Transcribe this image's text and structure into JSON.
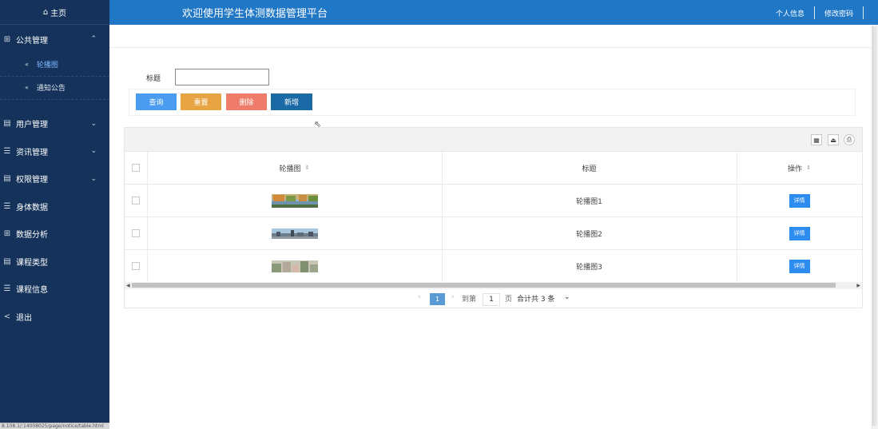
{
  "sidebar": {
    "home": "主页",
    "menu": [
      {
        "label": "公共管理",
        "icon": "grid-icon",
        "chevron": "up"
      },
      {
        "label": "用户管理",
        "icon": "doc-icon",
        "chevron": "down"
      },
      {
        "label": "资讯管理",
        "icon": "list-icon",
        "chevron": "down"
      },
      {
        "label": "权限管理",
        "icon": "doc-icon",
        "chevron": "down"
      },
      {
        "label": "身体数据",
        "icon": "list-icon"
      },
      {
        "label": "数据分析",
        "icon": "grid-icon"
      },
      {
        "label": "课程类型",
        "icon": "doc-icon"
      },
      {
        "label": "课程信息",
        "icon": "list-icon"
      },
      {
        "label": "退出",
        "icon": "share-icon"
      }
    ],
    "submenu": [
      {
        "label": "轮播图",
        "active": true
      },
      {
        "label": "通知公告",
        "active": false
      }
    ],
    "status_url": "8.108.1/:14008025/page/notice/table.html"
  },
  "header": {
    "title": "欢迎使用学生体测数据管理平台",
    "profile": "个人信息",
    "change_password": "修改密码"
  },
  "search": {
    "label": "标题",
    "value": "",
    "placeholder": ""
  },
  "buttons": {
    "query": "查询",
    "reset": "重置",
    "delete": "删除",
    "add": "新增"
  },
  "colors": {
    "sidebar_bg": "#14325a",
    "header_bg": "#1f77c6",
    "query": "#4a9cf0",
    "reset": "#e8a443",
    "delete": "#ef7b6b",
    "add": "#1b6aa5",
    "detail": "#2d8cf0",
    "page_active": "#5a9bd5"
  },
  "table": {
    "columns": [
      "轮播图",
      "标题",
      "操作"
    ],
    "rows": [
      {
        "title": "轮播图1",
        "action": "详情",
        "image": "landscape-photo-1"
      },
      {
        "title": "轮播图2",
        "action": "详情",
        "image": "landscape-photo-2"
      },
      {
        "title": "轮播图3",
        "action": "详情",
        "image": "landscape-photo-3"
      }
    ]
  },
  "pagination": {
    "current": "1",
    "goto_label": "到第",
    "goto_value": "1",
    "page_unit": "页",
    "total": "合计共 3 条"
  }
}
